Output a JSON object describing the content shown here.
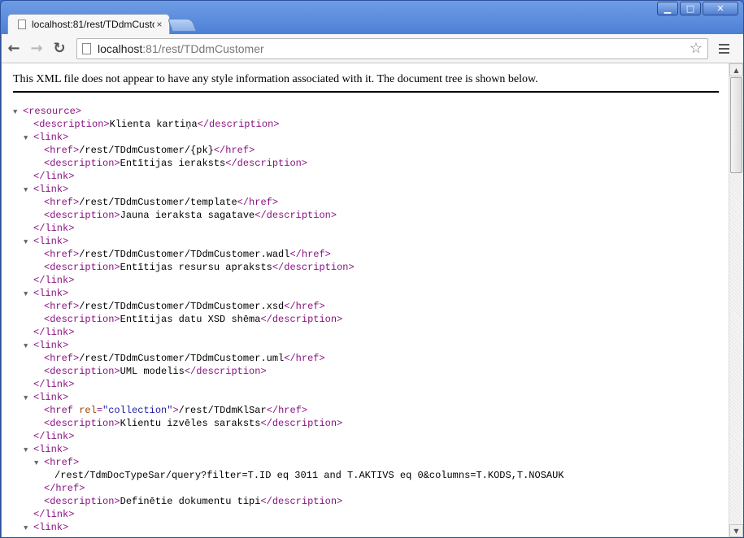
{
  "window": {
    "controls": {
      "minimize": "▁",
      "maximize": "□",
      "close": "✕"
    }
  },
  "tab": {
    "title": "localhost:81/rest/TDdmCusto",
    "close": "×"
  },
  "toolbar": {
    "back": "←",
    "forward": "→",
    "reload": "↻",
    "url_host": "localhost",
    "url_rest": ":81/rest/TDdmCustomer",
    "star": "☆"
  },
  "page": {
    "notice": "This XML file does not appear to have any style information associated with it. The document tree is shown below.",
    "xml_lines": [
      {
        "indent": 0,
        "tri": "▼",
        "parts": [
          {
            "t": "tag",
            "v": "<resource>"
          }
        ]
      },
      {
        "indent": 1,
        "tri": "",
        "parts": [
          {
            "t": "tag",
            "v": "<description>"
          },
          {
            "t": "text",
            "v": "Klienta kartiņa"
          },
          {
            "t": "tag",
            "v": "</description>"
          }
        ]
      },
      {
        "indent": 1,
        "tri": "▼",
        "parts": [
          {
            "t": "tag",
            "v": "<link>"
          }
        ]
      },
      {
        "indent": 2,
        "tri": "",
        "parts": [
          {
            "t": "tag",
            "v": "<href>"
          },
          {
            "t": "text",
            "v": "/rest/TDdmCustomer/{pk}"
          },
          {
            "t": "tag",
            "v": "</href>"
          }
        ]
      },
      {
        "indent": 2,
        "tri": "",
        "parts": [
          {
            "t": "tag",
            "v": "<description>"
          },
          {
            "t": "text",
            "v": "Entītijas ieraksts"
          },
          {
            "t": "tag",
            "v": "</description>"
          }
        ]
      },
      {
        "indent": 1,
        "tri": "",
        "parts": [
          {
            "t": "tag",
            "v": "</link>"
          }
        ]
      },
      {
        "indent": 1,
        "tri": "▼",
        "parts": [
          {
            "t": "tag",
            "v": "<link>"
          }
        ]
      },
      {
        "indent": 2,
        "tri": "",
        "parts": [
          {
            "t": "tag",
            "v": "<href>"
          },
          {
            "t": "text",
            "v": "/rest/TDdmCustomer/template"
          },
          {
            "t": "tag",
            "v": "</href>"
          }
        ]
      },
      {
        "indent": 2,
        "tri": "",
        "parts": [
          {
            "t": "tag",
            "v": "<description>"
          },
          {
            "t": "text",
            "v": "Jauna ieraksta sagatave"
          },
          {
            "t": "tag",
            "v": "</description>"
          }
        ]
      },
      {
        "indent": 1,
        "tri": "",
        "parts": [
          {
            "t": "tag",
            "v": "</link>"
          }
        ]
      },
      {
        "indent": 1,
        "tri": "▼",
        "parts": [
          {
            "t": "tag",
            "v": "<link>"
          }
        ]
      },
      {
        "indent": 2,
        "tri": "",
        "parts": [
          {
            "t": "tag",
            "v": "<href>"
          },
          {
            "t": "text",
            "v": "/rest/TDdmCustomer/TDdmCustomer.wadl"
          },
          {
            "t": "tag",
            "v": "</href>"
          }
        ]
      },
      {
        "indent": 2,
        "tri": "",
        "parts": [
          {
            "t": "tag",
            "v": "<description>"
          },
          {
            "t": "text",
            "v": "Entītijas resursu apraksts"
          },
          {
            "t": "tag",
            "v": "</description>"
          }
        ]
      },
      {
        "indent": 1,
        "tri": "",
        "parts": [
          {
            "t": "tag",
            "v": "</link>"
          }
        ]
      },
      {
        "indent": 1,
        "tri": "▼",
        "parts": [
          {
            "t": "tag",
            "v": "<link>"
          }
        ]
      },
      {
        "indent": 2,
        "tri": "",
        "parts": [
          {
            "t": "tag",
            "v": "<href>"
          },
          {
            "t": "text",
            "v": "/rest/TDdmCustomer/TDdmCustomer.xsd"
          },
          {
            "t": "tag",
            "v": "</href>"
          }
        ]
      },
      {
        "indent": 2,
        "tri": "",
        "parts": [
          {
            "t": "tag",
            "v": "<description>"
          },
          {
            "t": "text",
            "v": "Entītijas datu XSD shēma"
          },
          {
            "t": "tag",
            "v": "</description>"
          }
        ]
      },
      {
        "indent": 1,
        "tri": "",
        "parts": [
          {
            "t": "tag",
            "v": "</link>"
          }
        ]
      },
      {
        "indent": 1,
        "tri": "▼",
        "parts": [
          {
            "t": "tag",
            "v": "<link>"
          }
        ]
      },
      {
        "indent": 2,
        "tri": "",
        "parts": [
          {
            "t": "tag",
            "v": "<href>"
          },
          {
            "t": "text",
            "v": "/rest/TDdmCustomer/TDdmCustomer.uml"
          },
          {
            "t": "tag",
            "v": "</href>"
          }
        ]
      },
      {
        "indent": 2,
        "tri": "",
        "parts": [
          {
            "t": "tag",
            "v": "<description>"
          },
          {
            "t": "text",
            "v": "UML modelis"
          },
          {
            "t": "tag",
            "v": "</description>"
          }
        ]
      },
      {
        "indent": 1,
        "tri": "",
        "parts": [
          {
            "t": "tag",
            "v": "</link>"
          }
        ]
      },
      {
        "indent": 1,
        "tri": "▼",
        "parts": [
          {
            "t": "tag",
            "v": "<link>"
          }
        ]
      },
      {
        "indent": 2,
        "tri": "",
        "parts": [
          {
            "t": "tag",
            "v": "<href "
          },
          {
            "t": "attr",
            "v": "rel"
          },
          {
            "t": "tag",
            "v": "="
          },
          {
            "t": "aval",
            "v": "\"collection\""
          },
          {
            "t": "tag",
            "v": ">"
          },
          {
            "t": "text",
            "v": "/rest/TDdmKlSar"
          },
          {
            "t": "tag",
            "v": "</href>"
          }
        ]
      },
      {
        "indent": 2,
        "tri": "",
        "parts": [
          {
            "t": "tag",
            "v": "<description>"
          },
          {
            "t": "text",
            "v": "Klientu izvēles saraksts"
          },
          {
            "t": "tag",
            "v": "</description>"
          }
        ]
      },
      {
        "indent": 1,
        "tri": "",
        "parts": [
          {
            "t": "tag",
            "v": "</link>"
          }
        ]
      },
      {
        "indent": 1,
        "tri": "▼",
        "parts": [
          {
            "t": "tag",
            "v": "<link>"
          }
        ]
      },
      {
        "indent": 2,
        "tri": "▼",
        "parts": [
          {
            "t": "tag",
            "v": "<href>"
          }
        ]
      },
      {
        "indent": 3,
        "tri": "",
        "parts": [
          {
            "t": "text",
            "v": "/rest/TdmDocTypeSar/query?filter=T.ID eq 3011 and T.AKTIVS eq 0&columns=T.KODS,T.NOSAUK"
          }
        ]
      },
      {
        "indent": 2,
        "tri": "",
        "parts": [
          {
            "t": "tag",
            "v": "</href>"
          }
        ]
      },
      {
        "indent": 2,
        "tri": "",
        "parts": [
          {
            "t": "tag",
            "v": "<description>"
          },
          {
            "t": "text",
            "v": "Definētie dokumentu tipi"
          },
          {
            "t": "tag",
            "v": "</description>"
          }
        ]
      },
      {
        "indent": 1,
        "tri": "",
        "parts": [
          {
            "t": "tag",
            "v": "</link>"
          }
        ]
      },
      {
        "indent": 1,
        "tri": "▼",
        "parts": [
          {
            "t": "tag",
            "v": "<link>"
          }
        ]
      }
    ]
  },
  "scrollbar": {
    "up": "▲",
    "down": "▼"
  }
}
